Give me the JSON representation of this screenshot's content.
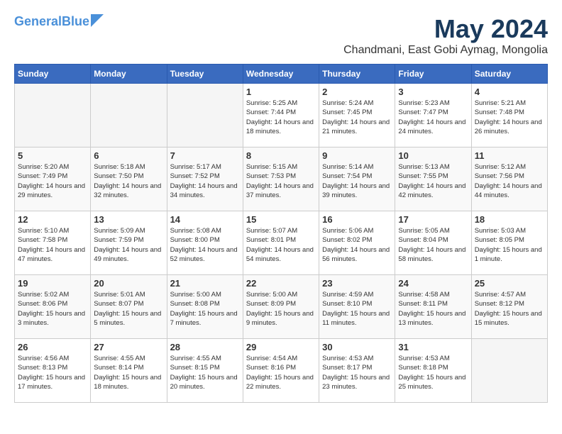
{
  "header": {
    "logo_general": "General",
    "logo_blue": "Blue",
    "month_title": "May 2024",
    "location": "Chandmani, East Gobi Aymag, Mongolia"
  },
  "days_of_week": [
    "Sunday",
    "Monday",
    "Tuesday",
    "Wednesday",
    "Thursday",
    "Friday",
    "Saturday"
  ],
  "weeks": [
    [
      {
        "day": "",
        "empty": true
      },
      {
        "day": "",
        "empty": true
      },
      {
        "day": "",
        "empty": true
      },
      {
        "day": "1",
        "sunrise": "5:25 AM",
        "sunset": "7:44 PM",
        "daylight": "14 hours and 18 minutes."
      },
      {
        "day": "2",
        "sunrise": "5:24 AM",
        "sunset": "7:45 PM",
        "daylight": "14 hours and 21 minutes."
      },
      {
        "day": "3",
        "sunrise": "5:23 AM",
        "sunset": "7:47 PM",
        "daylight": "14 hours and 24 minutes."
      },
      {
        "day": "4",
        "sunrise": "5:21 AM",
        "sunset": "7:48 PM",
        "daylight": "14 hours and 26 minutes."
      }
    ],
    [
      {
        "day": "5",
        "sunrise": "5:20 AM",
        "sunset": "7:49 PM",
        "daylight": "14 hours and 29 minutes."
      },
      {
        "day": "6",
        "sunrise": "5:18 AM",
        "sunset": "7:50 PM",
        "daylight": "14 hours and 32 minutes."
      },
      {
        "day": "7",
        "sunrise": "5:17 AM",
        "sunset": "7:52 PM",
        "daylight": "14 hours and 34 minutes."
      },
      {
        "day": "8",
        "sunrise": "5:15 AM",
        "sunset": "7:53 PM",
        "daylight": "14 hours and 37 minutes."
      },
      {
        "day": "9",
        "sunrise": "5:14 AM",
        "sunset": "7:54 PM",
        "daylight": "14 hours and 39 minutes."
      },
      {
        "day": "10",
        "sunrise": "5:13 AM",
        "sunset": "7:55 PM",
        "daylight": "14 hours and 42 minutes."
      },
      {
        "day": "11",
        "sunrise": "5:12 AM",
        "sunset": "7:56 PM",
        "daylight": "14 hours and 44 minutes."
      }
    ],
    [
      {
        "day": "12",
        "sunrise": "5:10 AM",
        "sunset": "7:58 PM",
        "daylight": "14 hours and 47 minutes."
      },
      {
        "day": "13",
        "sunrise": "5:09 AM",
        "sunset": "7:59 PM",
        "daylight": "14 hours and 49 minutes."
      },
      {
        "day": "14",
        "sunrise": "5:08 AM",
        "sunset": "8:00 PM",
        "daylight": "14 hours and 52 minutes."
      },
      {
        "day": "15",
        "sunrise": "5:07 AM",
        "sunset": "8:01 PM",
        "daylight": "14 hours and 54 minutes."
      },
      {
        "day": "16",
        "sunrise": "5:06 AM",
        "sunset": "8:02 PM",
        "daylight": "14 hours and 56 minutes."
      },
      {
        "day": "17",
        "sunrise": "5:05 AM",
        "sunset": "8:04 PM",
        "daylight": "14 hours and 58 minutes."
      },
      {
        "day": "18",
        "sunrise": "5:03 AM",
        "sunset": "8:05 PM",
        "daylight": "15 hours and 1 minute."
      }
    ],
    [
      {
        "day": "19",
        "sunrise": "5:02 AM",
        "sunset": "8:06 PM",
        "daylight": "15 hours and 3 minutes."
      },
      {
        "day": "20",
        "sunrise": "5:01 AM",
        "sunset": "8:07 PM",
        "daylight": "15 hours and 5 minutes."
      },
      {
        "day": "21",
        "sunrise": "5:00 AM",
        "sunset": "8:08 PM",
        "daylight": "15 hours and 7 minutes."
      },
      {
        "day": "22",
        "sunrise": "5:00 AM",
        "sunset": "8:09 PM",
        "daylight": "15 hours and 9 minutes."
      },
      {
        "day": "23",
        "sunrise": "4:59 AM",
        "sunset": "8:10 PM",
        "daylight": "15 hours and 11 minutes."
      },
      {
        "day": "24",
        "sunrise": "4:58 AM",
        "sunset": "8:11 PM",
        "daylight": "15 hours and 13 minutes."
      },
      {
        "day": "25",
        "sunrise": "4:57 AM",
        "sunset": "8:12 PM",
        "daylight": "15 hours and 15 minutes."
      }
    ],
    [
      {
        "day": "26",
        "sunrise": "4:56 AM",
        "sunset": "8:13 PM",
        "daylight": "15 hours and 17 minutes."
      },
      {
        "day": "27",
        "sunrise": "4:55 AM",
        "sunset": "8:14 PM",
        "daylight": "15 hours and 18 minutes."
      },
      {
        "day": "28",
        "sunrise": "4:55 AM",
        "sunset": "8:15 PM",
        "daylight": "15 hours and 20 minutes."
      },
      {
        "day": "29",
        "sunrise": "4:54 AM",
        "sunset": "8:16 PM",
        "daylight": "15 hours and 22 minutes."
      },
      {
        "day": "30",
        "sunrise": "4:53 AM",
        "sunset": "8:17 PM",
        "daylight": "15 hours and 23 minutes."
      },
      {
        "day": "31",
        "sunrise": "4:53 AM",
        "sunset": "8:18 PM",
        "daylight": "15 hours and 25 minutes."
      },
      {
        "day": "",
        "empty": true
      }
    ]
  ]
}
